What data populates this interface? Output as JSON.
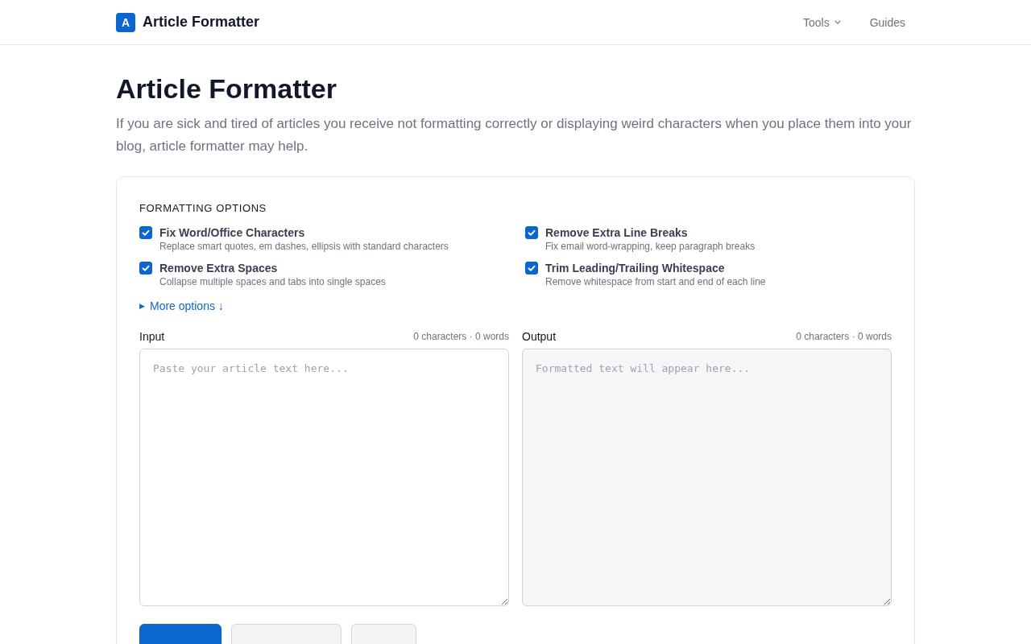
{
  "header": {
    "logo_letter": "A",
    "brand": "Article Formatter",
    "nav": [
      {
        "label": "Tools",
        "dropdown": true
      },
      {
        "label": "Guides",
        "dropdown": false
      }
    ]
  },
  "title": "Article Formatter",
  "description": "If you are sick and tired of articles you receive not formatting correctly or displaying weird characters when you place them into your blog, article formatter may help.",
  "options": {
    "heading": "FORMATTING OPTIONS",
    "items": [
      {
        "label": "Fix Word/Office Characters",
        "hint": "Replace smart quotes, em dashes, ellipsis with standard characters",
        "checked": true
      },
      {
        "label": "Remove Extra Line Breaks",
        "hint": "Fix email word-wrapping, keep paragraph breaks",
        "checked": true
      },
      {
        "label": "Remove Extra Spaces",
        "hint": "Collapse multiple spaces and tabs into single spaces",
        "checked": true
      },
      {
        "label": "Trim Leading/Trailing Whitespace",
        "hint": "Remove whitespace from start and end of each line",
        "checked": true
      }
    ],
    "more": {
      "marker": "▶",
      "label": "More options ↓",
      "expanded": false
    }
  },
  "panes": [
    {
      "label": "Input",
      "count": "0 characters · 0 words",
      "placeholder": "Paste your article text here...",
      "kind": "input"
    },
    {
      "label": "Output",
      "count": "0 characters · 0 words",
      "placeholder": "Formatted text will appear here...",
      "kind": "output"
    }
  ],
  "buttons": [
    {
      "kind": "primary"
    },
    {
      "kind": "secondary"
    },
    {
      "kind": "secondary"
    }
  ]
}
